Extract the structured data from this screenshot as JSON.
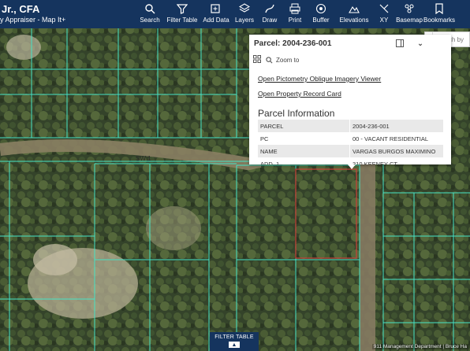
{
  "header": {
    "title": "Jr., CFA",
    "subtitle": "y Appraiser - Map It+"
  },
  "toolbar": [
    {
      "label": "Search",
      "icon": "search-icon"
    },
    {
      "label": "Filter Table",
      "icon": "filter-icon"
    },
    {
      "label": "Add Data",
      "icon": "add-data-icon"
    },
    {
      "label": "Layers",
      "icon": "layers-icon"
    },
    {
      "label": "Draw",
      "icon": "draw-icon"
    },
    {
      "label": "Print",
      "icon": "print-icon"
    },
    {
      "label": "Buffer",
      "icon": "buffer-icon"
    },
    {
      "label": "Elevations",
      "icon": "elevations-icon"
    },
    {
      "label": "XY",
      "icon": "xy-icon"
    },
    {
      "label": "Basemap",
      "icon": "basemap-icon"
    },
    {
      "label": "Bookmarks",
      "icon": "bookmarks-icon"
    }
  ],
  "search": {
    "placeholder": "Search by"
  },
  "popup": {
    "title": "Parcel: 2004-236-001",
    "zoom_label": "Zoom to",
    "links": [
      "Open Pictometry Oblique Imagery Viewer",
      "Open Property Record Card"
    ],
    "section_title": "Parcel Information",
    "rows": [
      [
        "PARCEL",
        "2004-236-001"
      ],
      [
        "PC",
        "00 - VACANT RESIDENTIAL"
      ],
      [
        "NAME",
        "VARGAS BURGOS MAXIMINO"
      ],
      [
        "ADD_1",
        "310 KEENEY CT"
      ]
    ]
  },
  "filter_tab": {
    "label": "FILTER TABLE"
  },
  "map": {
    "road_label": "SW 1",
    "attribution": "911 Management Department | Bruce Ha"
  },
  "colors": {
    "header": "#15345e",
    "parcel_line": "#46e3c5",
    "selected_parcel": "#c9443b"
  }
}
